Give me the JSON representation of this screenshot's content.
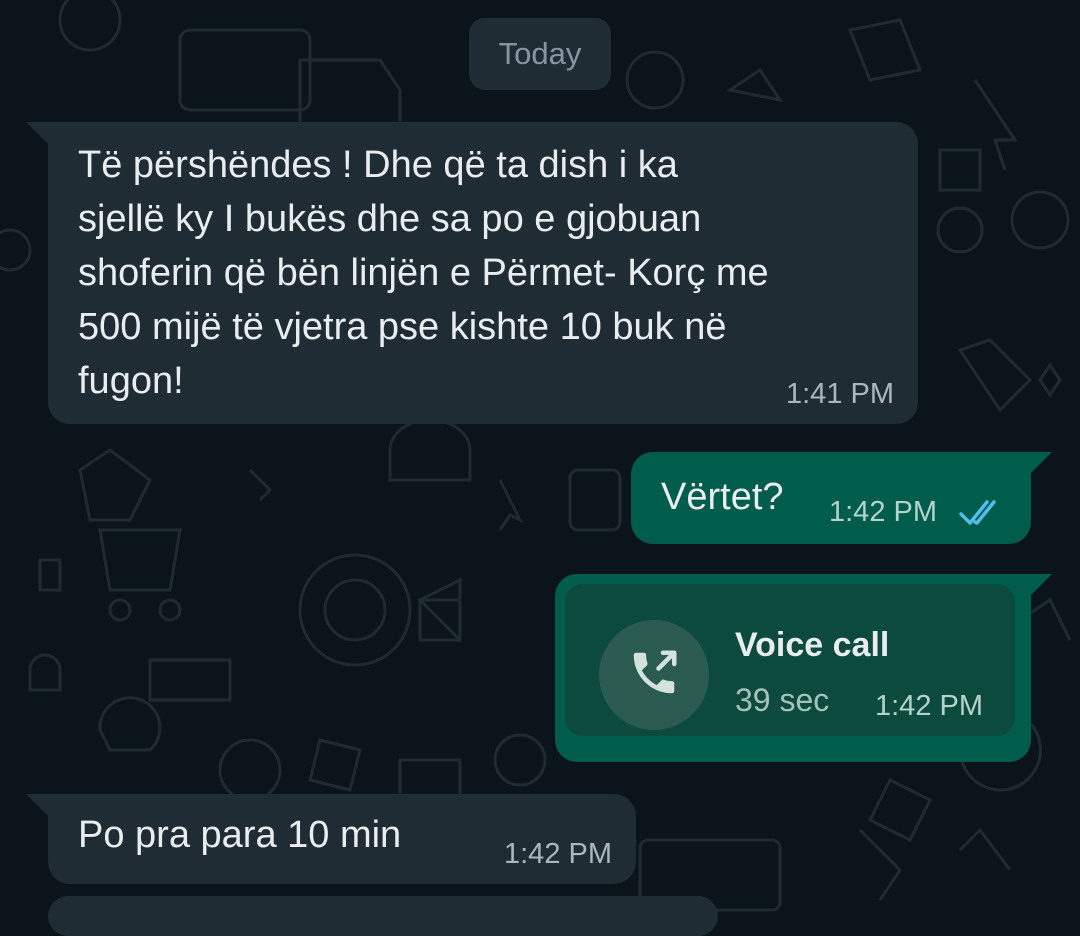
{
  "chat": {
    "date_label": "Today",
    "messages": [
      {
        "direction": "incoming",
        "text": "Të përshëndes ! Dhe që ta dish i ka\nsjellë ky I bukës dhe sa po e gjobuan\nshoferin që bën linjën e Përmet- Korç me\n500 mijë të vjetra pse kishte 10 buk në\nfugon!",
        "time": "1:41 PM"
      },
      {
        "direction": "outgoing",
        "text": "Vërtet?",
        "time": "1:42 PM",
        "status": "read"
      },
      {
        "direction": "outgoing",
        "type": "voice_call",
        "title": "Voice call",
        "duration": "39 sec",
        "time": "1:42 PM"
      },
      {
        "direction": "incoming",
        "text": "Po pra para 10 min",
        "time": "1:42 PM"
      }
    ]
  },
  "icons": {
    "read_receipt": "double-check-icon",
    "call": "outgoing-call-icon"
  },
  "colors": {
    "background": "#0b141a",
    "incoming_bubble": "#1f2c34",
    "outgoing_bubble": "#005c4b",
    "read_check": "#53bdeb"
  }
}
